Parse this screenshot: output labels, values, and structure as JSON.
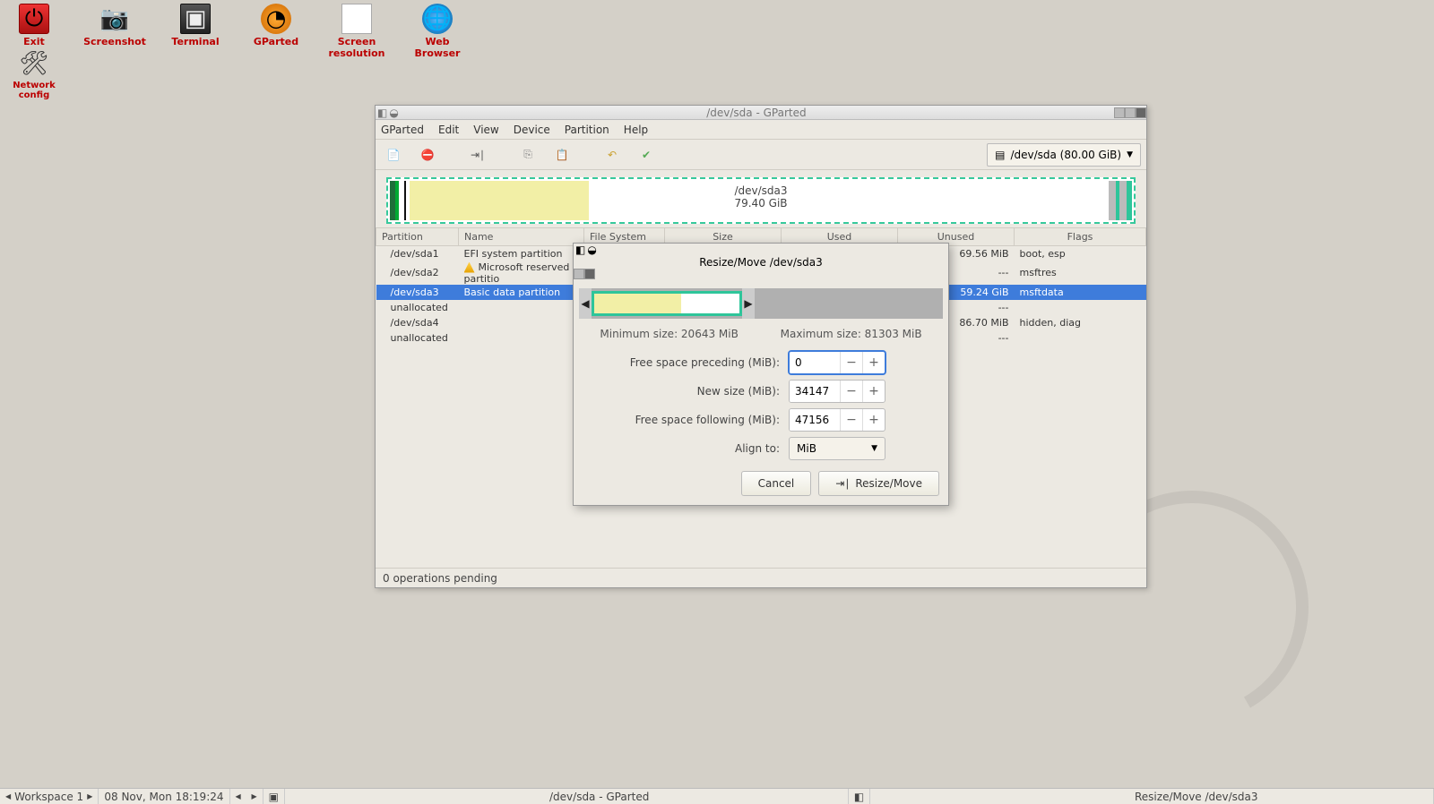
{
  "desktop": {
    "icons": [
      "Exit",
      "Screenshot",
      "Terminal",
      "GParted",
      "Screen resolution",
      "Web Browser"
    ],
    "row2": [
      "Network config"
    ]
  },
  "gparted": {
    "title": "/dev/sda - GParted",
    "menus": [
      "GParted",
      "Edit",
      "View",
      "Device",
      "Partition",
      "Help"
    ],
    "device_selector": "/dev/sda (80.00 GiB)",
    "graph": {
      "label_dev": "/dev/sda3",
      "label_size": "79.40 GiB"
    },
    "cols": [
      "Partition",
      "Name",
      "File System",
      "Size",
      "Used",
      "Unused",
      "Flags"
    ],
    "rows": [
      {
        "part": "/dev/sda1",
        "name": "EFI system partition",
        "fs": "",
        "size": "",
        "used": "",
        "unused": "69.56 MiB",
        "flags": "boot, esp"
      },
      {
        "part": "/dev/sda2",
        "name": "Microsoft reserved partitio",
        "warn": true,
        "fs": "",
        "size": "",
        "used": "",
        "unused": "---",
        "flags": "msftres"
      },
      {
        "part": "/dev/sda3",
        "name": "Basic data partition",
        "sel": true,
        "fs": "",
        "size": "",
        "used": "",
        "unused": "59.24 GiB",
        "flags": "msftdata"
      },
      {
        "part": "unallocated",
        "name": "",
        "fs": "",
        "size": "",
        "used": "",
        "unused": "---",
        "flags": ""
      },
      {
        "part": "/dev/sda4",
        "name": "",
        "fs": "",
        "size": "",
        "used": "",
        "unused": "86.70 MiB",
        "flags": "hidden, diag"
      },
      {
        "part": "unallocated",
        "name": "",
        "fs": "",
        "size": "",
        "used": "",
        "unused": "---",
        "flags": ""
      }
    ],
    "status": "0 operations pending"
  },
  "dialog": {
    "title": "Resize/Move /dev/sda3",
    "min_label": "Minimum size: 20643 MiB",
    "max_label": "Maximum size: 81303 MiB",
    "rows": {
      "preceding": {
        "label": "Free space preceding (MiB):",
        "value": "0"
      },
      "newsize": {
        "label": "New size (MiB):",
        "value": "34147"
      },
      "following": {
        "label": "Free space following (MiB):",
        "value": "47156"
      },
      "align": {
        "label": "Align to:",
        "value": "MiB"
      }
    },
    "buttons": {
      "cancel": "Cancel",
      "apply": "Resize/Move"
    }
  },
  "taskbar": {
    "workspace": "Workspace 1",
    "clock": "08 Nov, Mon 18:19:24",
    "task1": "/dev/sda - GParted",
    "task2": "Resize/Move /dev/sda3"
  }
}
